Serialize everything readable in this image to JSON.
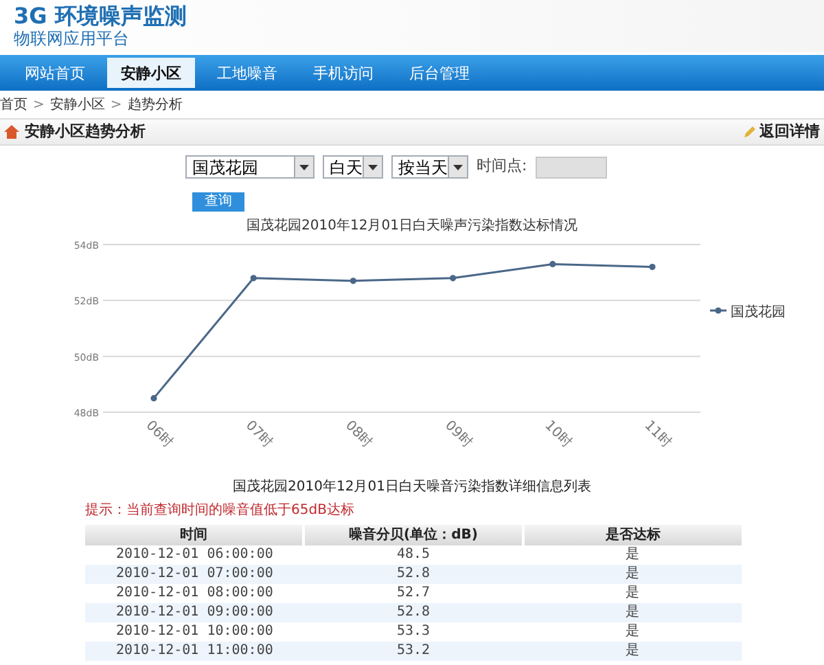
{
  "logo": {
    "title": "3G 环境噪声监测",
    "subtitle": "物联网应用平台"
  },
  "nav": [
    {
      "label": "网站首页",
      "selected": false
    },
    {
      "label": "安静小区",
      "selected": true
    },
    {
      "label": "工地噪音",
      "selected": false
    },
    {
      "label": "手机访问",
      "selected": false
    },
    {
      "label": "后台管理",
      "selected": false
    }
  ],
  "breadcrumb": [
    "首页",
    "安静小区",
    "趋势分析"
  ],
  "breadcrumb_separator": ">",
  "section": {
    "title": "安静小区趋势分析",
    "link": "返回详情"
  },
  "filters": {
    "site": "国茂花园",
    "period": "白天",
    "mode": "按当天",
    "time_label": "时间点:",
    "query_button": "查询"
  },
  "chart": {
    "chart_data": {
      "type": "line",
      "title": "国茂花园2010年12月01日白天噪声污染指数达标情况",
      "categories": [
        "06时",
        "07时",
        "08时",
        "09时",
        "10时",
        "11时"
      ],
      "series": [
        {
          "name": "国茂花园",
          "color": "#4a6788",
          "marker": "circle",
          "values": [
            48.5,
            52.8,
            52.7,
            52.8,
            53.3,
            53.2
          ]
        }
      ],
      "ylim": [
        48,
        54
      ],
      "yticks": [
        {
          "value": 48,
          "label": "48dB"
        },
        {
          "value": 50,
          "label": "50dB"
        },
        {
          "value": 52,
          "label": "52dB"
        },
        {
          "value": 54,
          "label": "54dB"
        }
      ]
    }
  },
  "table": {
    "title": "国茂花园2010年12月01日白天噪音污染指数详细信息列表",
    "hint": "提示：当前查询时间的噪音值低于65dB达标",
    "columns": [
      "时间",
      "噪音分贝(单位：dB)",
      "是否达标"
    ],
    "rows": [
      [
        "2010-12-01 06:00:00",
        "48.5",
        "是"
      ],
      [
        "2010-12-01 07:00:00",
        "52.8",
        "是"
      ],
      [
        "2010-12-01 08:00:00",
        "52.7",
        "是"
      ],
      [
        "2010-12-01 09:00:00",
        "52.8",
        "是"
      ],
      [
        "2010-12-01 10:00:00",
        "53.3",
        "是"
      ],
      [
        "2010-12-01 11:00:00",
        "53.2",
        "是"
      ]
    ]
  }
}
